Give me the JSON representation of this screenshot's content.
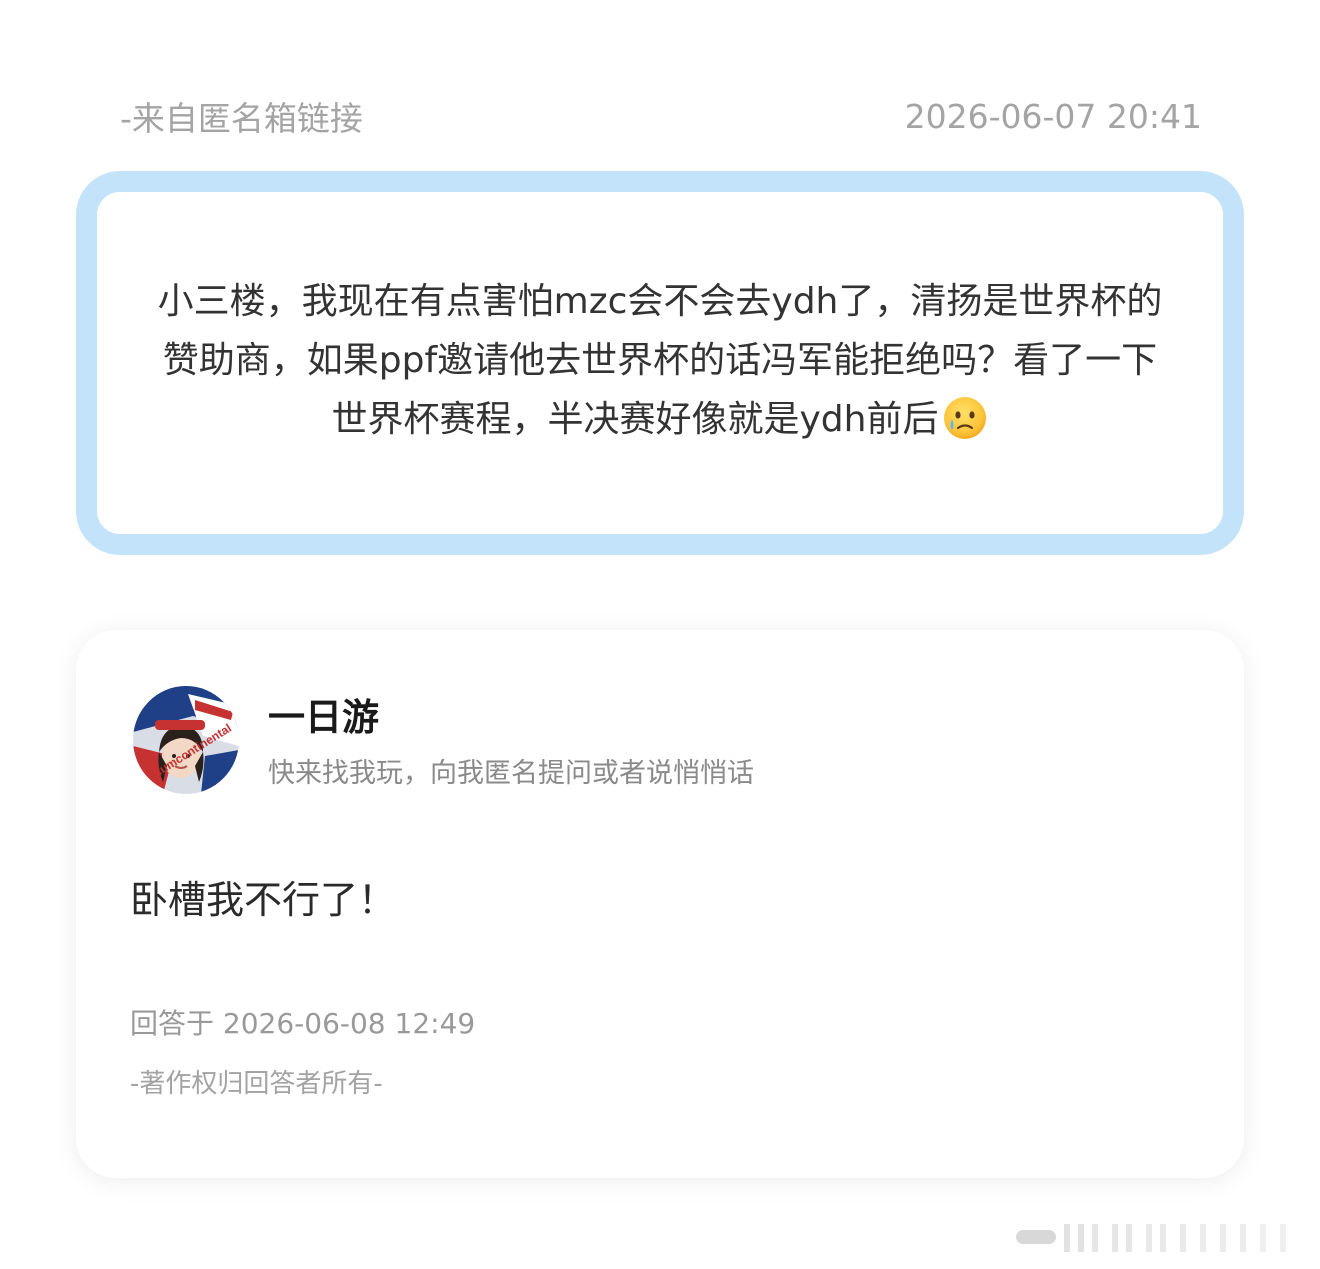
{
  "question": {
    "source": "-来自匿名箱链接",
    "timestamp": "2026-06-07 20:41",
    "text": "小三楼，我现在有点害怕mzc会不会去ydh了，清扬是世界杯的赞助商，如果ppf邀请他去世界杯的话冯军能拒绝吗？看了一下世界杯赛程，半决赛好像就是ydh前后",
    "emoji": "face-holding-back-tears-icon",
    "border_color": "#c3e3fb"
  },
  "answer": {
    "user_name": "一日游",
    "user_bio": "快来找我玩，向我匿名提问或者说悄悄话",
    "avatar_caption": "Circumcontinental",
    "text": "卧槽我不行了！",
    "answered_at": "回答于 2026-06-08 12:49",
    "copyright": "-著作权归回答者所有-"
  },
  "colors": {
    "muted_text": "#a4a4a4",
    "body_text": "#333333",
    "background": "#ffffff"
  }
}
